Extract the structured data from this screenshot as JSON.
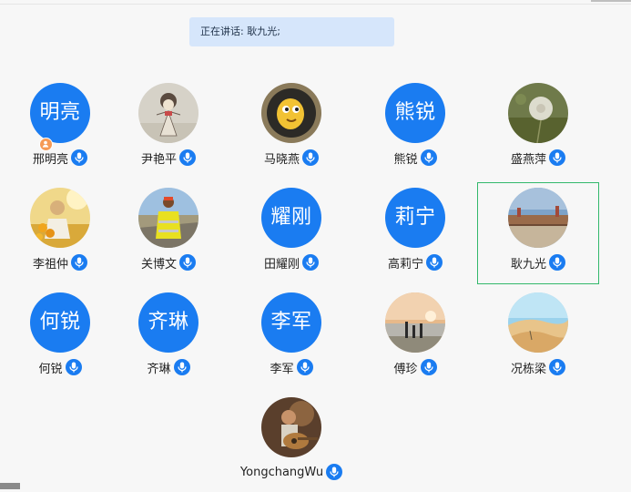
{
  "banner": {
    "text": "正在讲话: 耿九光;"
  },
  "colors": {
    "avatar_blue": "#1a7cf1",
    "mic_blue": "#1a7cf1",
    "speaker_frame": "#33b86b",
    "host_badge": "#f59a55"
  },
  "participants": [
    {
      "name": "邢明亮",
      "avatar_text": "明亮",
      "avatar": "initials",
      "host": true
    },
    {
      "name": "尹艳平",
      "avatar": "photo-cartoon-girl-sketch"
    },
    {
      "name": "马晓燕",
      "avatar": "photo-cartoon-bird"
    },
    {
      "name": "熊锐",
      "avatar_text": "熊锐",
      "avatar": "initials"
    },
    {
      "name": "盛燕萍",
      "avatar": "photo-dandelion"
    },
    {
      "name": "李祖仲",
      "avatar": "photo-sunflower-field"
    },
    {
      "name": "关博文",
      "avatar": "photo-worker-safety-vest"
    },
    {
      "name": "田耀刚",
      "avatar_text": "耀刚",
      "avatar": "initials"
    },
    {
      "name": "高莉宁",
      "avatar_text": "莉宁",
      "avatar": "initials"
    },
    {
      "name": "耿九光",
      "avatar": "photo-city-wall",
      "speaking": true
    },
    {
      "name": "何锐",
      "avatar_text": "何锐",
      "avatar": "initials"
    },
    {
      "name": "齐琳",
      "avatar_text": "齐琳",
      "avatar": "initials"
    },
    {
      "name": "李军",
      "avatar_text": "李军",
      "avatar": "initials"
    },
    {
      "name": "傅珍",
      "avatar": "photo-beach-sunset-family"
    },
    {
      "name": "况栋梁",
      "avatar": "photo-desert-dunes"
    },
    {
      "name": "YongchangWu",
      "avatar": "photo-guitar-player"
    }
  ]
}
